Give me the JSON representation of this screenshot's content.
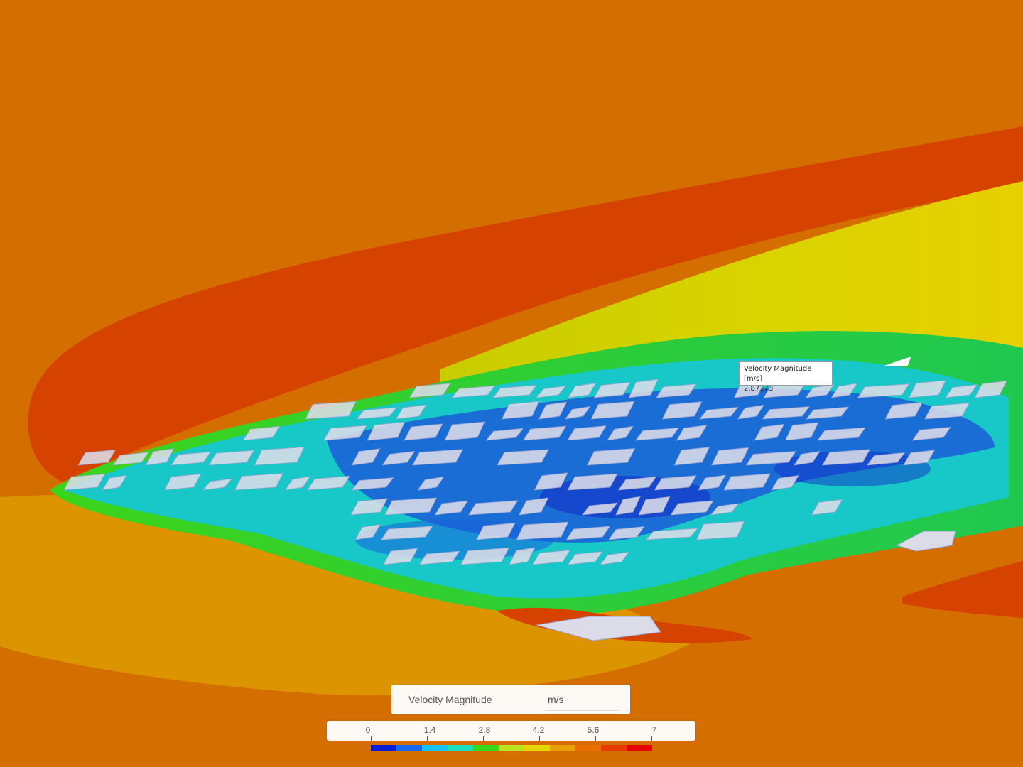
{
  "probe": {
    "label": "Velocity Magnitude [m/s]",
    "value": "2.87173"
  },
  "legend": {
    "title": "Velocity Magnitude",
    "unit": "m/s",
    "ticks": [
      "0",
      "1.4",
      "2.8",
      "4.2",
      "5.6",
      "7"
    ],
    "range": [
      0,
      7
    ],
    "colormap": [
      "#0a1dd4",
      "#1668f0",
      "#17c3f2",
      "#18e0c0",
      "#3ad81c",
      "#b8e21a",
      "#e4d400",
      "#e8a200",
      "#ea6d00",
      "#e43a00",
      "#e60000"
    ]
  },
  "field_colors": {
    "background": "#d46e00",
    "wake_core": "#d64200",
    "lower_band": "#dc9400",
    "transition": "#c8cc00",
    "mid": "#3cd41a",
    "low": "#18c8c8",
    "lowest": "#1230c8",
    "buildings": "#dcdce8"
  }
}
